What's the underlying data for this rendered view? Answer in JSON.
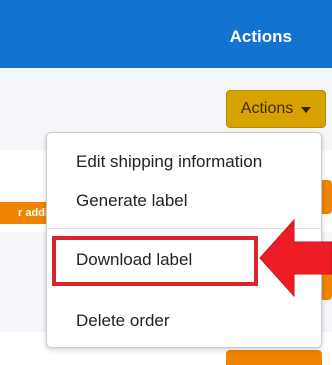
{
  "table": {
    "header": {
      "actions_heading": "Actions"
    }
  },
  "row_tag": {
    "text": "r addi"
  },
  "actions_dropdown": {
    "toggle_label": "Actions",
    "items": [
      {
        "label": "Edit shipping information"
      },
      {
        "label": "Generate label"
      },
      {
        "label": "Download label"
      },
      {
        "label": "Delete order"
      }
    ]
  },
  "colors": {
    "header_bg": "#1373d1",
    "actions_button_bg": "#d8a201",
    "orange_button": "#f08400",
    "highlight_red": "#d8262e"
  },
  "icons": {
    "toggle_caret": "caret-down-icon",
    "annotation": "left-arrow-icon"
  }
}
